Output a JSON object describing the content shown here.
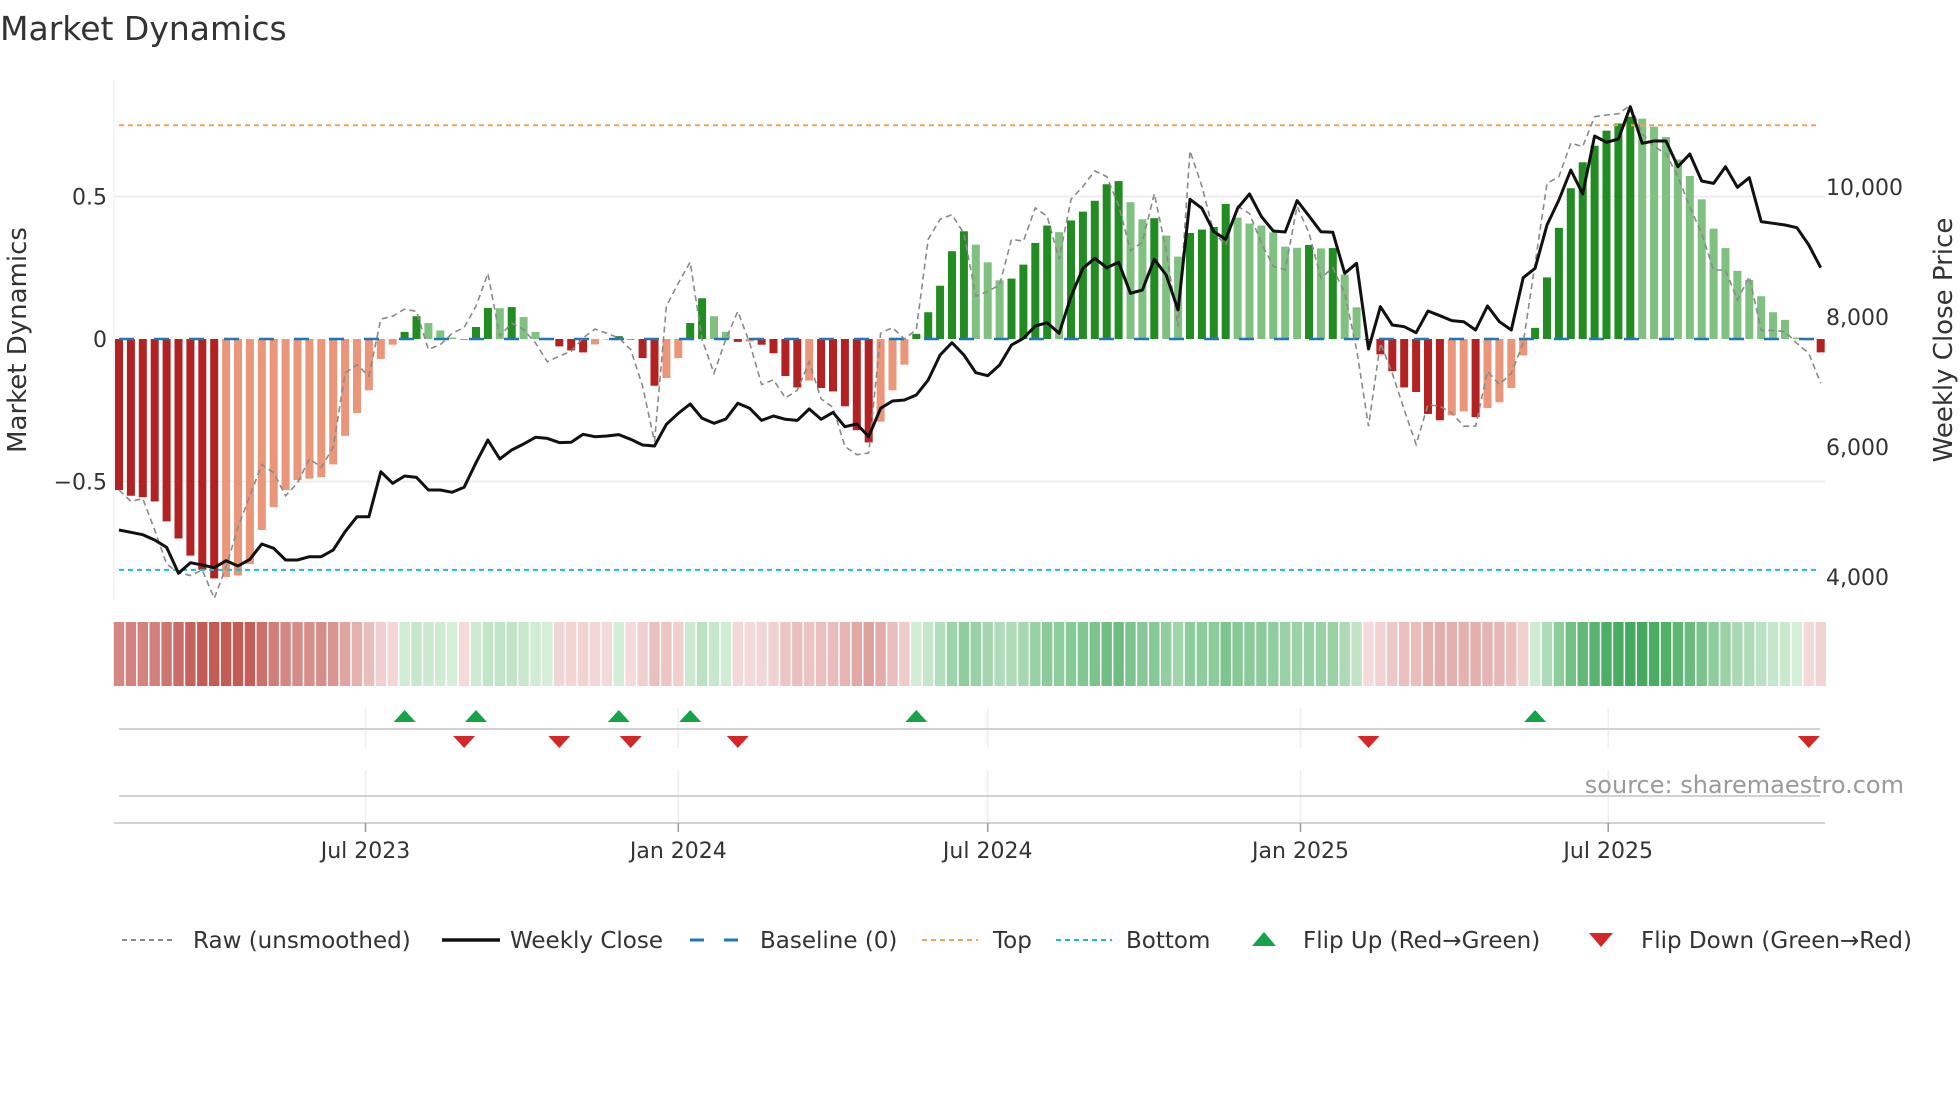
{
  "title": "Market Dynamics",
  "source_label": "source: sharemaestro.com",
  "colors": {
    "bar_neg_strong": "#b22222",
    "bar_neg_weak": "#e9967a",
    "bar_pos_strong": "#228b22",
    "bar_pos_weak": "#80c080",
    "raw": "#8a8a8a",
    "close": "#111111",
    "baseline": "#1f77b4",
    "top": "#f0a35e",
    "bottom": "#17becf",
    "flip_up": "#17a34a",
    "flip_down": "#d62728"
  },
  "chart_data": {
    "type": "bar",
    "title": "Market Dynamics",
    "ylabel": "Market Dynamics",
    "y2label": "Weekly Close Price",
    "ylim": [
      -0.91,
      0.96
    ],
    "y2lim": [
      3850,
      11900
    ],
    "grid": true,
    "legend_placement": "bottom",
    "x_start": "2023-02-06",
    "x_interval_days": 7,
    "y_ticks": [
      {
        "value": 0.5,
        "label": "0.5"
      },
      {
        "value": 0,
        "label": "0"
      },
      {
        "value": -0.5,
        "label": "−0.5"
      }
    ],
    "y2_ticks": [
      {
        "value": 10000,
        "label": "10,000"
      },
      {
        "value": 8000,
        "label": "8,000"
      },
      {
        "value": 6000,
        "label": "6,000"
      },
      {
        "value": 4000,
        "label": "4,000"
      }
    ],
    "x_ticks": [
      {
        "date": "2023-07-01",
        "label": "Jul 2023"
      },
      {
        "date": "2024-01-01",
        "label": "Jan 2024"
      },
      {
        "date": "2024-07-01",
        "label": "Jul 2024"
      },
      {
        "date": "2025-01-01",
        "label": "Jan 2025"
      },
      {
        "date": "2025-07-01",
        "label": "Jul 2025"
      }
    ],
    "levels": {
      "top": 0.75,
      "bottom": -0.81,
      "baseline": 0
    },
    "histogram": [
      -0.53,
      -0.55,
      -0.555,
      -0.57,
      -0.64,
      -0.7,
      -0.76,
      -0.81,
      -0.84,
      -0.835,
      -0.83,
      -0.79,
      -0.67,
      -0.59,
      -0.53,
      -0.495,
      -0.49,
      -0.485,
      -0.44,
      -0.34,
      -0.26,
      -0.18,
      -0.07,
      -0.02,
      0.025,
      0.08,
      0.056,
      0.03,
      0.005,
      -0.002,
      0.042,
      0.109,
      0.108,
      0.112,
      0.077,
      0.025,
      0.002,
      -0.026,
      -0.04,
      -0.047,
      -0.019,
      -0.002,
      0.01,
      -0.002,
      -0.067,
      -0.164,
      -0.137,
      -0.067,
      0.056,
      0.143,
      0.08,
      0.025,
      -0.01,
      -0.009,
      -0.02,
      -0.05,
      -0.13,
      -0.17,
      -0.146,
      -0.172,
      -0.184,
      -0.236,
      -0.32,
      -0.363,
      -0.29,
      -0.18,
      -0.09,
      0.018,
      0.094,
      0.187,
      0.308,
      0.378,
      0.331,
      0.269,
      0.206,
      0.212,
      0.261,
      0.337,
      0.398,
      0.375,
      0.416,
      0.447,
      0.485,
      0.543,
      0.554,
      0.48,
      0.42,
      0.424,
      0.363,
      0.289,
      0.372,
      0.384,
      0.393,
      0.474,
      0.426,
      0.405,
      0.398,
      0.374,
      0.324,
      0.32,
      0.33,
      0.318,
      0.319,
      0.226,
      0.111,
      -0.003,
      -0.054,
      -0.113,
      -0.17,
      -0.186,
      -0.263,
      -0.285,
      -0.268,
      -0.254,
      -0.274,
      -0.242,
      -0.222,
      -0.172,
      -0.058,
      0.039,
      0.216,
      0.39,
      0.529,
      0.62,
      0.678,
      0.731,
      0.756,
      0.78,
      0.773,
      0.745,
      0.709,
      0.63,
      0.572,
      0.49,
      0.387,
      0.319,
      0.239,
      0.207,
      0.15,
      0.094,
      0.067,
      0.005,
      -0.004,
      -0.047
    ],
    "raw": [
      -0.53,
      -0.57,
      -0.56,
      -0.67,
      -0.79,
      -0.82,
      -0.83,
      -0.81,
      -0.91,
      -0.8,
      -0.66,
      -0.55,
      -0.44,
      -0.47,
      -0.55,
      -0.505,
      -0.42,
      -0.45,
      -0.38,
      -0.12,
      -0.09,
      -0.13,
      0.07,
      0.08,
      0.105,
      0.097,
      -0.037,
      -0.02,
      0.02,
      0.04,
      0.115,
      0.23,
      0.01,
      0.056,
      0.033,
      -0.014,
      -0.08,
      -0.06,
      -0.043,
      0.004,
      0.035,
      0.02,
      0.004,
      -0.037,
      -0.166,
      -0.36,
      0.115,
      0.196,
      0.27,
      -0.002,
      -0.12,
      0.0,
      0.097,
      -0.014,
      -0.16,
      -0.143,
      -0.207,
      -0.18,
      -0.08,
      -0.21,
      -0.24,
      -0.377,
      -0.406,
      -0.4,
      0.02,
      0.04,
      0.0,
      0.033,
      0.35,
      0.42,
      0.436,
      0.37,
      0.15,
      0.167,
      0.19,
      0.35,
      0.343,
      0.46,
      0.43,
      0.28,
      0.49,
      0.535,
      0.59,
      0.57,
      0.47,
      0.31,
      0.34,
      0.51,
      0.31,
      0.044,
      0.66,
      0.536,
      0.373,
      0.33,
      0.466,
      0.44,
      0.337,
      0.255,
      0.243,
      0.466,
      0.372,
      0.214,
      0.25,
      0.161,
      -0.037,
      -0.306,
      -0.014,
      -0.12,
      -0.248,
      -0.37,
      -0.23,
      -0.236,
      -0.26,
      -0.306,
      -0.306,
      -0.113,
      -0.16,
      -0.12,
      -0.015,
      0.265,
      0.546,
      0.57,
      0.687,
      0.675,
      0.78,
      0.786,
      0.79,
      0.82,
      0.72,
      0.675,
      0.65,
      0.57,
      0.464,
      0.37,
      0.242,
      0.242,
      0.137,
      0.219,
      0.03,
      0.03,
      0.026,
      -0.015,
      -0.05,
      -0.155
    ],
    "weekly_close": [
      4723,
      4688,
      4651,
      4569,
      4457,
      4057,
      4220,
      4185,
      4143,
      4251,
      4169,
      4272,
      4508,
      4441,
      4262,
      4262,
      4313,
      4313,
      4415,
      4697,
      4928,
      4928,
      5620,
      5441,
      5554,
      5533,
      5338,
      5338,
      5303,
      5380,
      5759,
      6108,
      5815,
      5954,
      6046,
      6149,
      6133,
      6067,
      6072,
      6195,
      6159,
      6169,
      6190,
      6118,
      6031,
      6015,
      6349,
      6518,
      6662,
      6441,
      6364,
      6431,
      6672,
      6595,
      6410,
      6477,
      6426,
      6410,
      6585,
      6426,
      6533,
      6313,
      6354,
      6159,
      6595,
      6708,
      6723,
      6800,
      7031,
      7415,
      7605,
      7415,
      7143,
      7097,
      7262,
      7569,
      7672,
      7862,
      7913,
      7749,
      8313,
      8749,
      8903,
      8759,
      8841,
      8364,
      8415,
      8887,
      8646,
      8108,
      9811,
      9672,
      9313,
      9195,
      9672,
      9892,
      9544,
      9323,
      9308,
      9790,
      9554,
      9313,
      9303,
      8672,
      8826,
      7508,
      8159,
      7877,
      7851,
      7759,
      8092,
      8020,
      7944,
      7928,
      7800,
      8169,
      7928,
      7800,
      8605,
      8749,
      9415,
      9800,
      10262,
      9892,
      10785,
      10687,
      10738,
      11236,
      10672,
      10708,
      10708,
      10313,
      10508,
      10092,
      10056,
      10313,
      9995,
      10143,
      9467,
      9441,
      9415,
      9374,
      9108,
      8759
    ],
    "flips_up": [
      "2023-07-24",
      "2023-09-04",
      "2023-11-27",
      "2024-01-08",
      "2024-05-20",
      "2025-05-19"
    ],
    "flips_down": [
      "2023-08-28",
      "2023-10-23",
      "2023-12-04",
      "2024-02-05",
      "2025-02-10",
      "2025-10-27"
    ]
  },
  "legend": [
    {
      "key": "raw",
      "label": "Raw (unsmoothed)"
    },
    {
      "key": "close",
      "label": "Weekly Close"
    },
    {
      "key": "baseline",
      "label": "Baseline (0)"
    },
    {
      "key": "top",
      "label": "Top"
    },
    {
      "key": "bottom",
      "label": "Bottom"
    },
    {
      "key": "flip_up",
      "label": "Flip Up (Red→Green)"
    },
    {
      "key": "flip_down",
      "label": "Flip Down (Green→Red)"
    }
  ]
}
